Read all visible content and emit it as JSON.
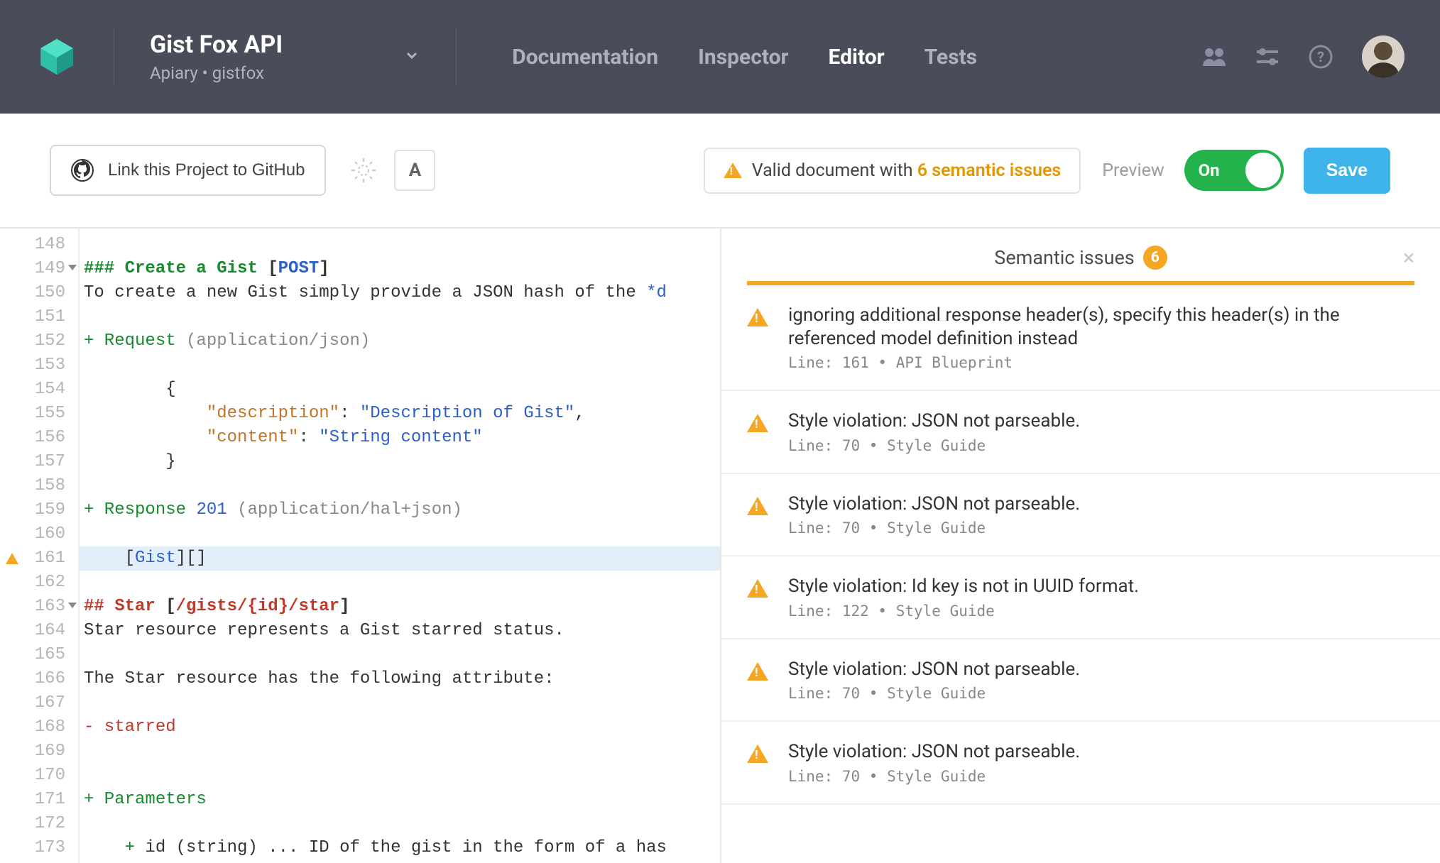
{
  "header": {
    "project_title": "Gist Fox API",
    "project_sub": "Apiary • gistfox",
    "nav": [
      {
        "label": "Documentation",
        "active": false
      },
      {
        "label": "Inspector",
        "active": false
      },
      {
        "label": "Editor",
        "active": true
      },
      {
        "label": "Tests",
        "active": false
      }
    ]
  },
  "toolbar": {
    "github_label": "Link this Project to GitHub",
    "font_btn": "A",
    "status_prefix": "Valid document with ",
    "status_count": "6 semantic issues",
    "preview_label": "Preview",
    "toggle_label": "On",
    "save_label": "Save"
  },
  "editor": {
    "lines": [
      {
        "n": 148,
        "html": ""
      },
      {
        "n": 149,
        "fold": true,
        "html": "<span class='tok-h'>### Create a Gist </span><span class='tok-brk'>[</span><span class='tok-method'>POST</span><span class='tok-brk'>]</span>"
      },
      {
        "n": 150,
        "html": "To create a new Gist simply provide a JSON hash of the <span class='tok-link'>*d</span>"
      },
      {
        "n": 151,
        "html": ""
      },
      {
        "n": 152,
        "html": "<span class='tok-plus'>+ Request </span><span class='tok-dim'>(application/json)</span>"
      },
      {
        "n": 153,
        "html": ""
      },
      {
        "n": 154,
        "html": "        {",
        "guide": 2
      },
      {
        "n": 155,
        "html": "            <span class='tok-key'>\"description\"</span>: <span class='tok-str'>\"Description of Gist\"</span>,",
        "guide": 2
      },
      {
        "n": 156,
        "html": "            <span class='tok-key'>\"content\"</span>: <span class='tok-str'>\"String content\"</span>",
        "guide": 2
      },
      {
        "n": 157,
        "html": "        }",
        "guide": 2
      },
      {
        "n": 158,
        "html": ""
      },
      {
        "n": 159,
        "html": "<span class='tok-plus'>+ Response </span><span class='tok-num'>201</span> <span class='tok-dim'>(application/hal+json)</span>"
      },
      {
        "n": 160,
        "html": ""
      },
      {
        "n": 161,
        "warn": true,
        "hl": true,
        "html": "    [<span class='tok-link'>Gist</span>][]",
        "guide": 1
      },
      {
        "n": 162,
        "html": ""
      },
      {
        "n": 163,
        "fold": true,
        "html": "<span class='tok-hh'>## Star </span><span class='tok-brk'>[</span><span class='tok-path'>/gists/{id}/star</span><span class='tok-brk'>]</span>"
      },
      {
        "n": 164,
        "html": "Star resource represents a Gist starred status."
      },
      {
        "n": 165,
        "html": ""
      },
      {
        "n": 166,
        "html": "The Star resource has the following attribute:"
      },
      {
        "n": 167,
        "html": ""
      },
      {
        "n": 168,
        "html": "<span class='tok-minus'>- starred</span>"
      },
      {
        "n": 169,
        "html": ""
      },
      {
        "n": 170,
        "html": ""
      },
      {
        "n": 171,
        "html": "<span class='tok-plus'>+ Parameters</span>"
      },
      {
        "n": 172,
        "html": ""
      },
      {
        "n": 173,
        "html": "    <span class='tok-plus'>+</span> id (string) ... ID of the gist in the form of a has"
      }
    ]
  },
  "issues": {
    "title": "Semantic issues",
    "count": "6",
    "items": [
      {
        "msg": "ignoring additional response header(s), specify this header(s) in the referenced model definition instead",
        "meta": "Line: 161 • API Blueprint"
      },
      {
        "msg": "Style violation: JSON not parseable.",
        "meta": "Line: 70 • Style Guide"
      },
      {
        "msg": "Style violation: JSON not parseable.",
        "meta": "Line: 70 • Style Guide"
      },
      {
        "msg": "Style violation: Id key is not in UUID format.",
        "meta": "Line: 122 • Style Guide"
      },
      {
        "msg": "Style violation: JSON not parseable.",
        "meta": "Line: 70 • Style Guide"
      },
      {
        "msg": "Style violation: JSON not parseable.",
        "meta": "Line: 70 • Style Guide"
      }
    ]
  }
}
